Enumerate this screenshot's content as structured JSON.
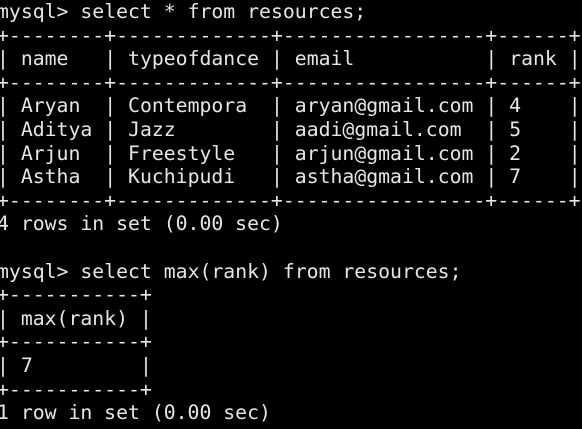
{
  "terminal": {
    "prompt": "mysql>",
    "sessions": [
      {
        "command": "select * from resources;",
        "table": {
          "columns": [
            "name",
            "typeofdance",
            "email",
            "rank"
          ],
          "rows": [
            [
              "Aryan",
              "Contempora",
              "aryan@gmail.com",
              "4"
            ],
            [
              "Aditya",
              "Jazz",
              "aadi@gmail.com",
              "5"
            ],
            [
              "Arjun",
              "Freestyle",
              "arjun@gmail.com",
              "2"
            ],
            [
              "Astha",
              "Kuchipudi",
              "astha@gmail.com",
              "7"
            ]
          ]
        },
        "footer": "4 rows in set (0.00 sec)"
      },
      {
        "command": "select max(rank) from resources;",
        "table": {
          "columns": [
            "max(rank)"
          ],
          "rows": [
            [
              "7"
            ]
          ]
        },
        "footer": "1 row in set (0.00 sec)"
      }
    ]
  }
}
